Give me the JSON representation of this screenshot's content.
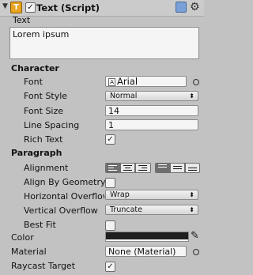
{
  "component": {
    "title": "Text (Script)",
    "enabled": true,
    "type_icon": "T"
  },
  "text": {
    "label": "Text",
    "value": "Lorem ipsum"
  },
  "character": {
    "header": "Character",
    "font": {
      "label": "Font",
      "value": "Arial",
      "icon": "font-asset-icon"
    },
    "font_style": {
      "label": "Font Style",
      "value": "Normal"
    },
    "font_size": {
      "label": "Font Size",
      "value": "14"
    },
    "line_spacing": {
      "label": "Line Spacing",
      "value": "1"
    },
    "rich_text": {
      "label": "Rich Text",
      "checked": true
    }
  },
  "paragraph": {
    "header": "Paragraph",
    "alignment": {
      "label": "Alignment",
      "horizontal_selected": "left",
      "vertical_selected": "top"
    },
    "align_by_geometry": {
      "label": "Align By Geometry",
      "checked": false
    },
    "horizontal_overflow": {
      "label": "Horizontal Overflow",
      "value": "Wrap"
    },
    "vertical_overflow": {
      "label": "Vertical Overflow",
      "value": "Truncate"
    },
    "best_fit": {
      "label": "Best Fit",
      "checked": false
    }
  },
  "color": {
    "label": "Color",
    "swatch": "#1e1e1e"
  },
  "material": {
    "label": "Material",
    "value": "None (Material)"
  },
  "raycast_target": {
    "label": "Raycast Target",
    "checked": true
  },
  "check_mark": "✓"
}
